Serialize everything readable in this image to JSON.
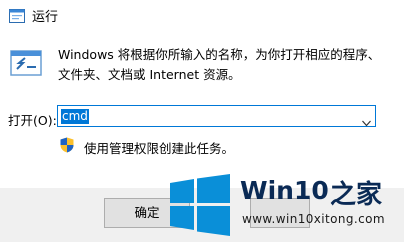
{
  "window": {
    "title": "运行"
  },
  "dialog": {
    "description": "Windows 将根据你所输入的名称，为你打开相应的程序、文件夹、文档或 Internet 资源。",
    "open_label": "打开(O):",
    "input_value": "cmd",
    "admin_note": "使用管理权限创建此任务。"
  },
  "buttons": {
    "ok_label": "确定"
  },
  "watermark": {
    "name": "Win10",
    "suffix": "之家",
    "url": "www.win10xitong.com"
  },
  "colors": {
    "accent": "#0078d7",
    "watermark_blue": "#0a2a55"
  },
  "icons": [
    "run-app-icon",
    "close-icon",
    "run-icon",
    "chevron-down-icon",
    "uac-shield-icon",
    "windows-logo-icon"
  ]
}
